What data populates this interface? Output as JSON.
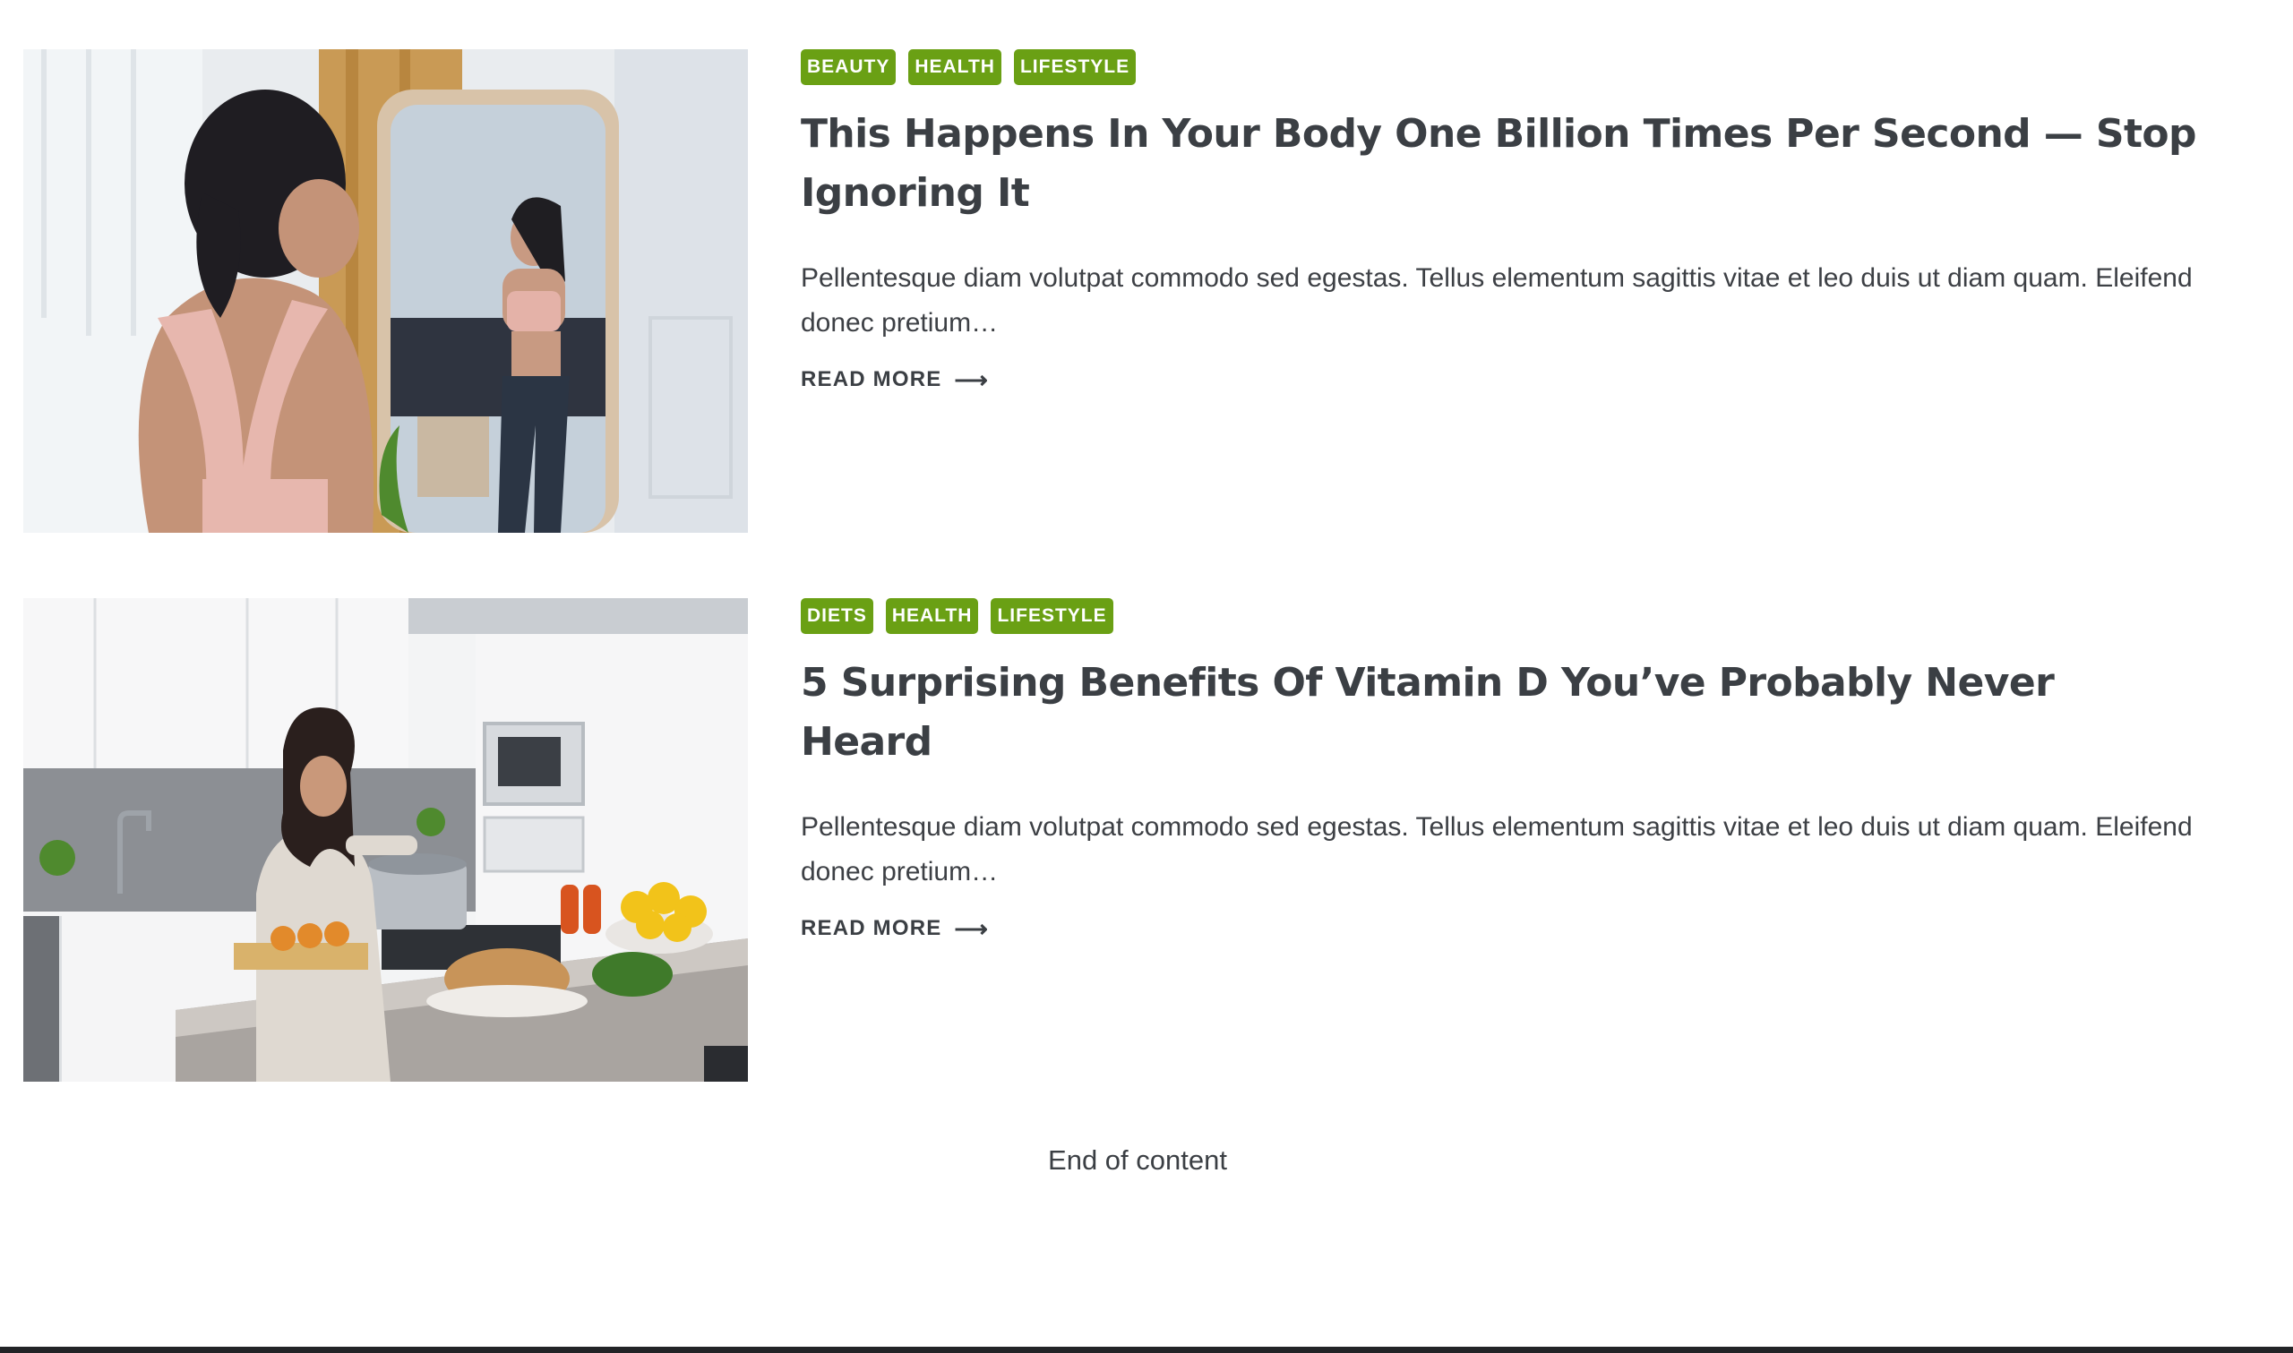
{
  "posts": [
    {
      "tags": [
        "BEAUTY",
        "HEALTH",
        "LIFESTYLE"
      ],
      "title": "This Happens In Your Body One Billion Times Per Second — Stop Ignoring It",
      "excerpt": "Pellentesque diam volutpat commodo sed egestas. Tellus elementum sagittis vitae et leo duis ut diam quam. Eleifend donec pretium…",
      "read_more": "READ MORE",
      "image_icon": "woman-mirror-photo"
    },
    {
      "tags": [
        "DIETS",
        "HEALTH",
        "LIFESTYLE"
      ],
      "title": "5 Surprising Benefits Of Vitamin D You’ve Probably Never Heard",
      "excerpt": "Pellentesque diam volutpat commodo sed egestas. Tellus elementum sagittis vitae et leo duis ut diam quam. Eleifend donec pretium…",
      "read_more": "READ MORE",
      "image_icon": "woman-kitchen-photo"
    }
  ],
  "read_more_icon": "arrow-right-icon",
  "end_of_content": "End of content",
  "colors": {
    "tag_background": "#6aa014",
    "tag_text": "#ffffff",
    "heading": "#3b3f44",
    "body_text": "#3d4045",
    "footer": "#222326"
  }
}
